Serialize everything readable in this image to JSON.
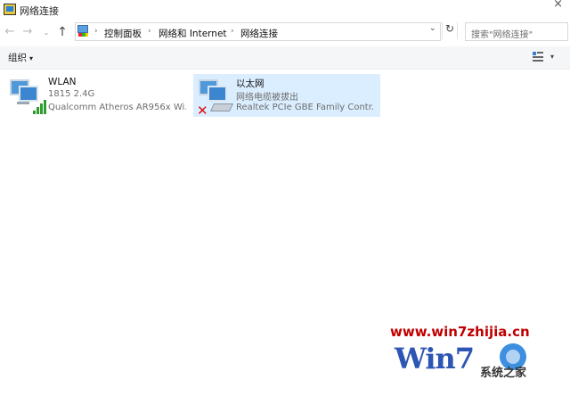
{
  "window": {
    "title": "网络连接",
    "close_glyph": "×"
  },
  "address": {
    "back_glyph": "←",
    "forward_glyph": "→",
    "recent_glyph": "⌄",
    "up_glyph": "↑",
    "crumbs": [
      "控制面板",
      "网络和 Internet",
      "网络连接"
    ],
    "separator": "›",
    "dropdown_glyph": "⌄",
    "refresh_glyph": "↻",
    "search_placeholder": "搜索\"网络连接\""
  },
  "toolbar": {
    "organize_label": "组织",
    "caret": "▾",
    "view_caret": "▾"
  },
  "connections": [
    {
      "name": "WLAN",
      "status": "1815 2.4G",
      "device": "Qualcomm Atheros AR956x Wi...",
      "icon": "wifi-signal-icon",
      "selected": false
    },
    {
      "name": "以太网",
      "status": "网络电缆被拔出",
      "device": "Realtek PCIe GBE Family Contr...",
      "icon": "ethernet-disconnected-icon",
      "selected": true
    }
  ],
  "watermark": {
    "url": "www.win7zhijia.cn",
    "logo_text": "Win7",
    "site_name": "系统之家"
  },
  "colors": {
    "selection": "#dbeeff",
    "toolbar_bg": "#f5f6f7",
    "signal_green": "#2f9e2f",
    "error_red": "#d11111",
    "watermark_red": "#c00000",
    "watermark_blue": "#2d55b4"
  }
}
